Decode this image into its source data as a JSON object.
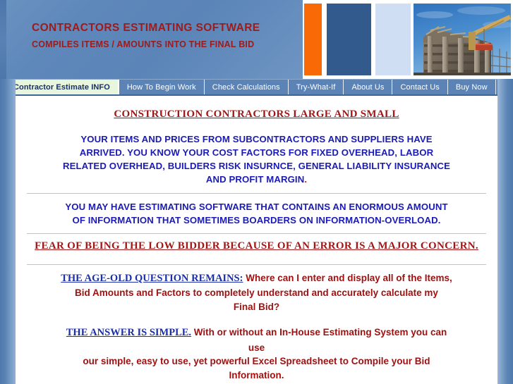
{
  "banner": {
    "title": "CONTRACTORS ESTIMATING SOFTWARE",
    "subtitle": "COMPILES ITEMS / AMOUNTS INTO THE FINAL BID",
    "title_color": "#9e1b1b",
    "background_color": "#5b84b8",
    "accent_stripe_color": "#f96a06",
    "navy_stripe_color": "#335a8c",
    "pale_stripe_color": "#cfdef2",
    "photo_alt": "construction-building-with-crane"
  },
  "nav": {
    "items": [
      {
        "label": "Contractor Estimate INFO",
        "active": true
      },
      {
        "label": "How To Begin Work",
        "active": false
      },
      {
        "label": "Check Calculations",
        "active": false
      },
      {
        "label": "Try-What-If",
        "active": false
      },
      {
        "label": "About Us",
        "active": false
      },
      {
        "label": "Contact Us",
        "active": false
      },
      {
        "label": "Buy Now",
        "active": false
      }
    ],
    "background_color": "#5b83b6",
    "active_background_color": "#e8f6dd",
    "active_text_color": "#1b2f62"
  },
  "content": {
    "heading": "CONSTRUCTION  CONTRACTORS  LARGE  AND  SMALL",
    "heading_color": "#a11616",
    "paragraph1_lines": [
      "YOUR ITEMS AND PRICES FROM SUBCONTRACTORS AND SUPPLIERS HAVE",
      "ARRIVED.   YOU KNOW YOUR COST FACTORS FOR FIXED OVERHEAD, LABOR",
      "RELATED OVERHEAD, BUILDERS RISK INSURNCE, GENERAL LIABILITY  INSURANCE",
      "AND  PROFIT MARGIN"
    ],
    "paragraph1_final_period": ".",
    "paragraph1_color": "#1b1bb5",
    "paragraph2_lines": [
      "YOU MAY HAVE ESTIMATING SOFTWARE THAT CONTAINS AN ENORMOUS AMOUNT",
      "OF INFORMATION THAT SOMETIMES BOARDERS ON INFORMATION-OVERLOAD."
    ],
    "fear_line": "FEAR OF BEING THE LOW BIDDER BECAUSE OF AN ERROR IS A MAJOR CONCERN.",
    "fear_color": "#a11616",
    "question_lead": "THE AGE-OLD QUESTION REMAINS:",
    "question_body_lines": [
      "   Where can I enter and display all of the Items,",
      "Bid Amounts and Factors to completely understand and accurately calculate my",
      "Final Bid?"
    ],
    "answer_lead": "THE ANSWER IS SIMPLE.",
    "answer_body_lines": [
      "   With or without an In-House Estimating System you can",
      "use"
    ],
    "answer_body2_lines": [
      "our simple, easy to use, yet powerful Excel Spreadsheet to Compile your Bid",
      "Information."
    ],
    "lead_color": "#1a2fa8",
    "body_red_color": "#a01111"
  }
}
